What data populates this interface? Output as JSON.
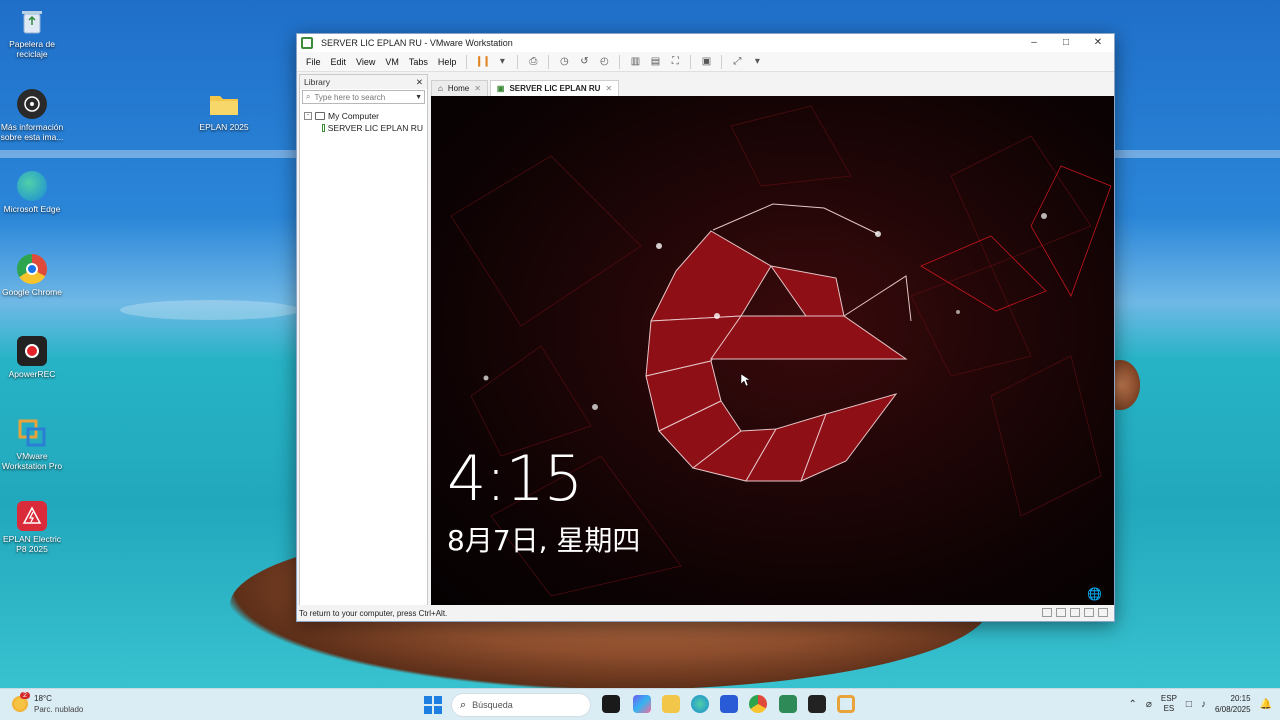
{
  "desktop": {
    "icons": [
      {
        "label": "Papelera de reciclaje",
        "icon": "recycle-bin-icon",
        "color": "#6aa7d8"
      },
      {
        "label": "Más información sobre esta ima...",
        "icon": "info-camera-icon",
        "color": "#2a2a2a"
      },
      {
        "label": "Microsoft Edge",
        "icon": "edge-icon",
        "color": "#1b8ad6"
      },
      {
        "label": "Google Chrome",
        "icon": "chrome-icon",
        "color": "#e04a3a"
      },
      {
        "label": "ApowerREC",
        "icon": "apowerrec-icon",
        "color": "#222222"
      },
      {
        "label": "VMware Workstation Pro",
        "icon": "vmware-icon",
        "color": "#e8a33b"
      },
      {
        "label": "EPLAN Electric P8 2025",
        "icon": "eplan-icon",
        "color": "#d92b3a"
      },
      {
        "label": "EPLAN 2025",
        "icon": "folder-icon",
        "color": "#f2c649"
      }
    ]
  },
  "vmware": {
    "title": "SERVER LIC EPLAN RU - VMware Workstation",
    "menu": [
      "File",
      "Edit",
      "View",
      "VM",
      "Tabs",
      "Help"
    ],
    "library": {
      "title": "Library",
      "search_placeholder": "Type here to search",
      "tree_root": "My Computer",
      "tree_child": "SERVER LIC EPLAN RU"
    },
    "tabs": [
      {
        "label": "Home"
      },
      {
        "label": "SERVER LIC EPLAN RU"
      }
    ],
    "status": "To return to your computer, press Ctrl+Alt."
  },
  "guest": {
    "time": "4:15",
    "date": "8月7日, 星期四",
    "accent": "#c4161c"
  },
  "taskbar": {
    "weather_temp": "18°C",
    "weather_desc": "Parc. nublado",
    "weather_badge": "2",
    "search_placeholder": "Búsqueda",
    "lang_top": "ESP",
    "lang_bottom": "ES",
    "time": "20:15",
    "date": "6/08/2025"
  }
}
